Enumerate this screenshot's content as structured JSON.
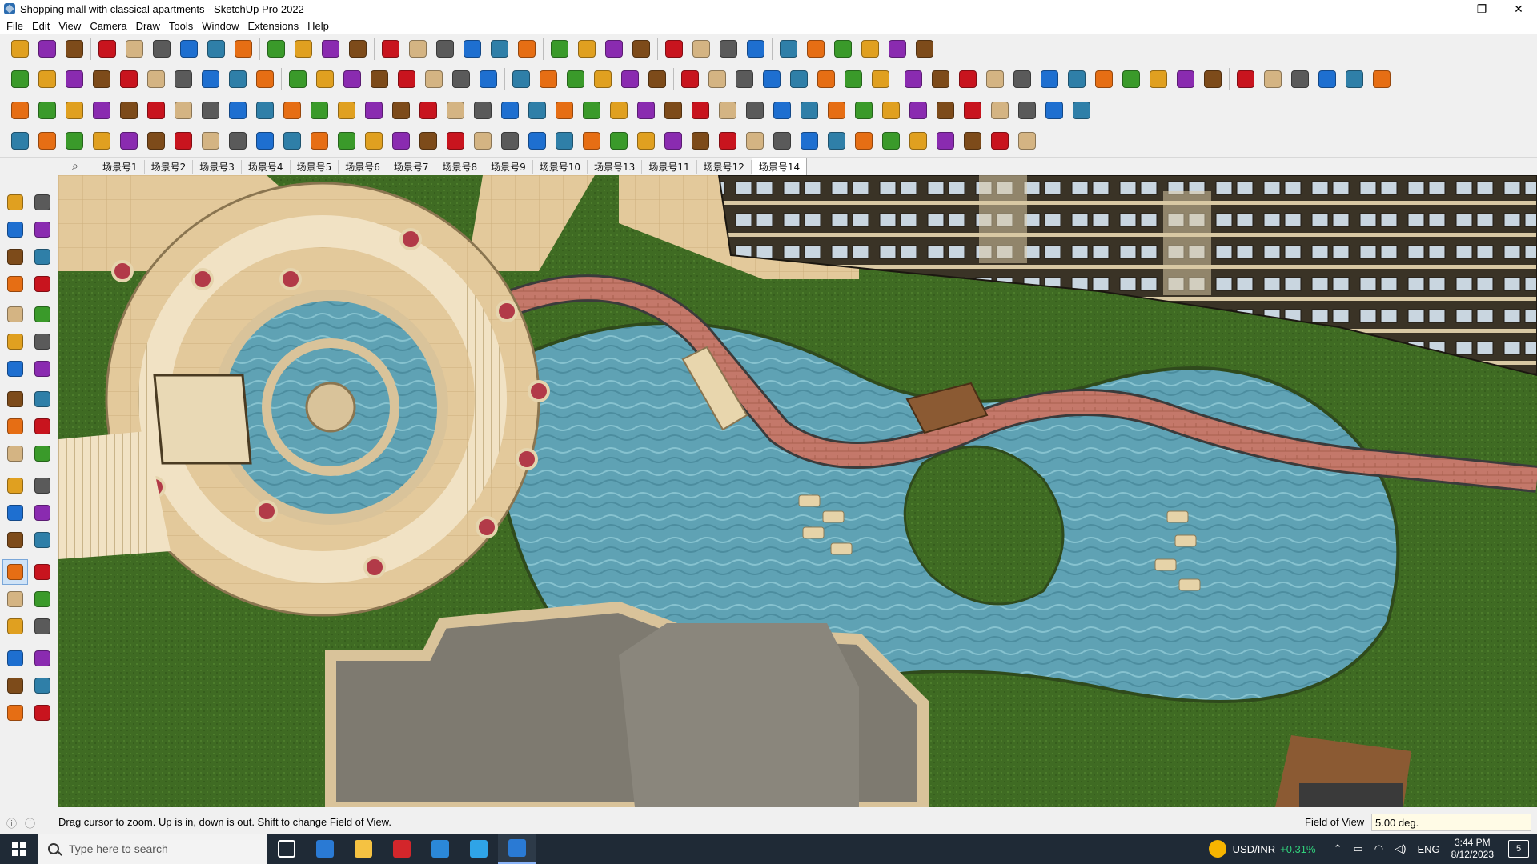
{
  "window": {
    "title": "Shopping mall with classical apartments - SketchUp Pro 2022",
    "minimize_glyph": "—",
    "maximize_glyph": "❐",
    "close_glyph": "✕"
  },
  "menu": [
    "File",
    "Edit",
    "View",
    "Camera",
    "Draw",
    "Tools",
    "Window",
    "Extensions",
    "Help"
  ],
  "toolbar_colors": [
    "#e0a020",
    "#c8141e",
    "#1e6fd0",
    "#3a9a2a",
    "#7d4b1a",
    "#5a5a5a",
    "#e66e14",
    "#8a2bb0",
    "#d4b483",
    "#2f7fa8"
  ],
  "scenes": {
    "search_icon": "magnifier-icon",
    "tabs": [
      "场景号1",
      "场景号2",
      "场景号3",
      "场景号4",
      "场景号5",
      "场景号6",
      "场景号7",
      "场景号8",
      "场景号9",
      "场景号10",
      "场景号13",
      "场景号11",
      "场景号12",
      "场景号14"
    ],
    "active_index": 13
  },
  "statusbar": {
    "message": "Drag cursor to zoom.  Up is in, down is out. Shift to change Field of View.",
    "vcb_label": "Field of View",
    "vcb_value": "5.00 deg."
  },
  "taskbar": {
    "search_placeholder": "Type here to search",
    "app_colors": [
      "#ffffff",
      "#2a7ad4",
      "#f5c242",
      "#d3262b",
      "#2b88d8",
      "#2fa4e7",
      "#2a7ad4"
    ],
    "ticker": "USD/INR",
    "ticker_change": "+0.31%",
    "language": "ENG",
    "time": "3:44 PM",
    "date": "8/12/2023",
    "notifications": "5"
  },
  "colors": {
    "grass": "#3f6b23",
    "water": "#5fa2b4",
    "paving": "#e3c99b",
    "brick_path": "#c4786a",
    "building": "#3a3326",
    "planter": "#b23a48"
  }
}
